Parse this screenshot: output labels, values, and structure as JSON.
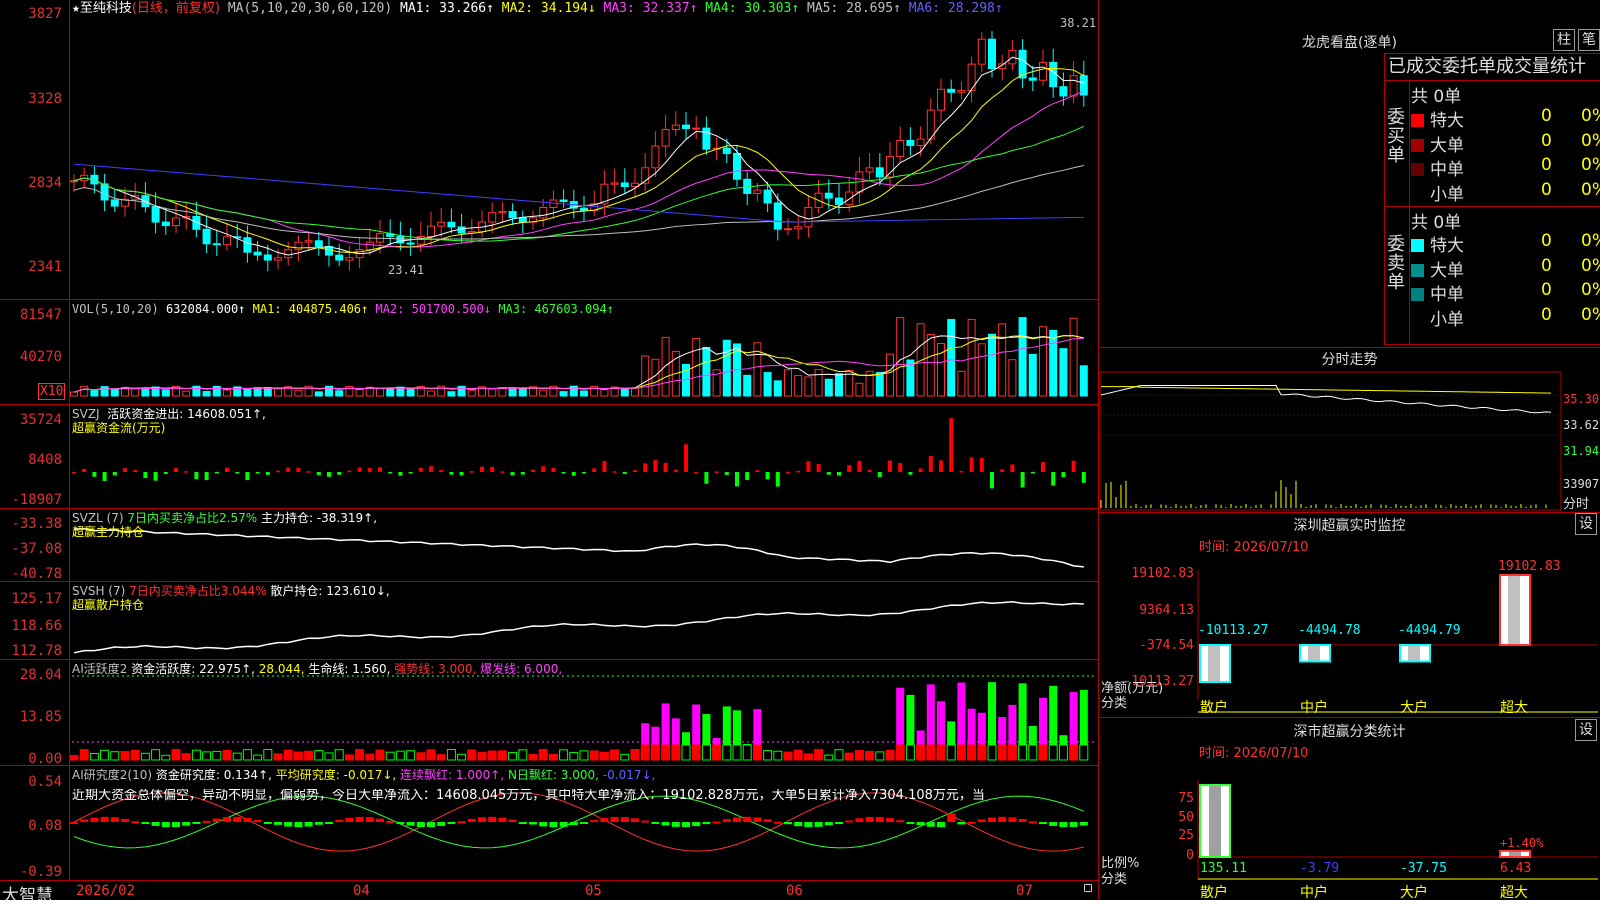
{
  "main_header": {
    "star": "★",
    "stock": "至纯科技",
    "mode": "(日线，前复权)",
    "ma_def": "MA(5,10,20,30,60,120)",
    "ma1": "MA1: 33.266↑",
    "ma2": "MA2: 34.194↓",
    "ma3": "MA3: 32.337↑",
    "ma4": "MA4: 30.303↑",
    "ma5": "MA5: 28.695↑",
    "ma6": "MA6: 28.298↑",
    "high_label": "38.21",
    "low_label": "23.41"
  },
  "axis": {
    "price": [
      "3827",
      "3328",
      "2834",
      "2341"
    ],
    "vol": [
      "81547",
      "40270"
    ],
    "vol_unit": "X10",
    "svzj": [
      "35724",
      "8408",
      "-18907"
    ],
    "svzl": [
      "-33.38",
      "-37.08",
      "-40.78"
    ],
    "svsh": [
      "125.17",
      "118.66",
      "112.78"
    ],
    "ai2": [
      "28.04",
      "13.85",
      "0.00"
    ],
    "ai3": [
      "0.54",
      "0.08",
      "-0.39"
    ]
  },
  "vol_header": {
    "name": "VOL(5,10,20)",
    "val": "632084.000↑",
    "ma1": "MA1: 404875.406↑",
    "ma2": "MA2: 501700.500↓",
    "ma3": "MA3: 467603.094↑"
  },
  "svzj_header": {
    "name": "SVZJ",
    "active": "活跃资金进出: 14608.051↑,",
    "line2": "超赢资金流(万元)"
  },
  "svzl_header": {
    "name": "SVZL (7)",
    "ratio": "7日内买卖净占比2.57%",
    "hold": "主力持仓: -38.319↑,",
    "line2": "超赢主力持仓"
  },
  "svsh_header": {
    "name": "SVSH (7)",
    "ratio": "7日内买卖净占比3.044%",
    "hold": "散户持仓: 123.610↓,",
    "line2": "超赢散户持仓"
  },
  "ai2_header": {
    "name": "AI活跃度2",
    "act": "资金活跃度: 22.975↑,",
    "v2": "28.044,",
    "life": "生命线: 1.560,",
    "strong": "强势线: 3.000,",
    "burst": "爆发线: 6.000,"
  },
  "ai3_header": {
    "name": "AI研究度2(10)",
    "res": "资金研究度: 0.134↑,",
    "avg": "平均研究度: -0.017↓,",
    "red": "连续飘红: 1.000↑,",
    "nred": "N日飘红: 3.000,",
    "last": "-0.017↓,",
    "summary": "近期大资金总体偏空，异动不明显，偏弱势，今日大单净流入：14608.045万元，其中特大单净流入：19102.828万元，大单5日累计净入7304.108万元，当"
  },
  "date_axis": {
    "brand": "大智慧",
    "labels": [
      "2026/02",
      "04",
      "05",
      "06",
      "07"
    ]
  },
  "dragon": {
    "title": "龙虎看盘(逐单)",
    "btn1": "柱",
    "btn2": "笔",
    "header": "已成交委托单成交量统计",
    "buy_label": "委买单",
    "sell_label": "委卖单",
    "buy_total": "共 0单",
    "sell_total": "共 0单",
    "buy_rows": [
      {
        "name": "特大",
        "val": "0",
        "pct": "0%",
        "color": "#ff0000"
      },
      {
        "name": "大单",
        "val": "0",
        "pct": "0%",
        "color": "#a00000"
      },
      {
        "name": "中单",
        "val": "0",
        "pct": "0%",
        "color": "#600000"
      },
      {
        "name": "小单",
        "val": "0",
        "pct": "0%",
        "color": "#000000"
      }
    ],
    "sell_rows": [
      {
        "name": "特大",
        "val": "0",
        "pct": "0%",
        "color": "#00ffff"
      },
      {
        "name": "大单",
        "val": "0",
        "pct": "0%",
        "color": "#009090"
      },
      {
        "name": "中单",
        "val": "0",
        "pct": "0%",
        "color": "#008080"
      },
      {
        "name": "小单",
        "val": "0",
        "pct": "0%",
        "color": "#000000"
      }
    ]
  },
  "intraday": {
    "title": "分时走势",
    "axis": [
      "35.30",
      "33.62",
      "31.94",
      "33907"
    ],
    "unit": "分时"
  },
  "sz_monitor": {
    "title": "深圳超赢实时监控",
    "btn": "设",
    "time": "时间: 2026/07/10",
    "axis": [
      "19102.83",
      "9364.13",
      "-374.54",
      "-10113.27"
    ],
    "bars": [
      {
        "label": "散户",
        "value": -10113.27,
        "text": "-10113.27"
      },
      {
        "label": "中户",
        "value": -4494.78,
        "text": "-4494.78"
      },
      {
        "label": "大户",
        "value": -4494.79,
        "text": "-4494.79"
      },
      {
        "label": "超大",
        "value": 19102.83,
        "text": "19102.83"
      }
    ],
    "unit1": "净额(万元)",
    "unit2": "分类"
  },
  "sz_class": {
    "title": "深市超赢分类统计",
    "btn": "设",
    "time": "时间: 2026/07/10",
    "axis": [
      "75",
      "50",
      "25",
      "0"
    ],
    "pct_label": "+1.40%",
    "unit1": "比例%",
    "unit2": "分类",
    "bars": [
      {
        "label": "散户",
        "value": 135.11,
        "text": "135.11"
      },
      {
        "label": "中户",
        "value": -3.79,
        "text": "-3.79"
      },
      {
        "label": "大户",
        "value": -37.75,
        "text": "-37.75"
      },
      {
        "label": "超大",
        "value": 6.43,
        "text": "6.43"
      }
    ]
  }
}
